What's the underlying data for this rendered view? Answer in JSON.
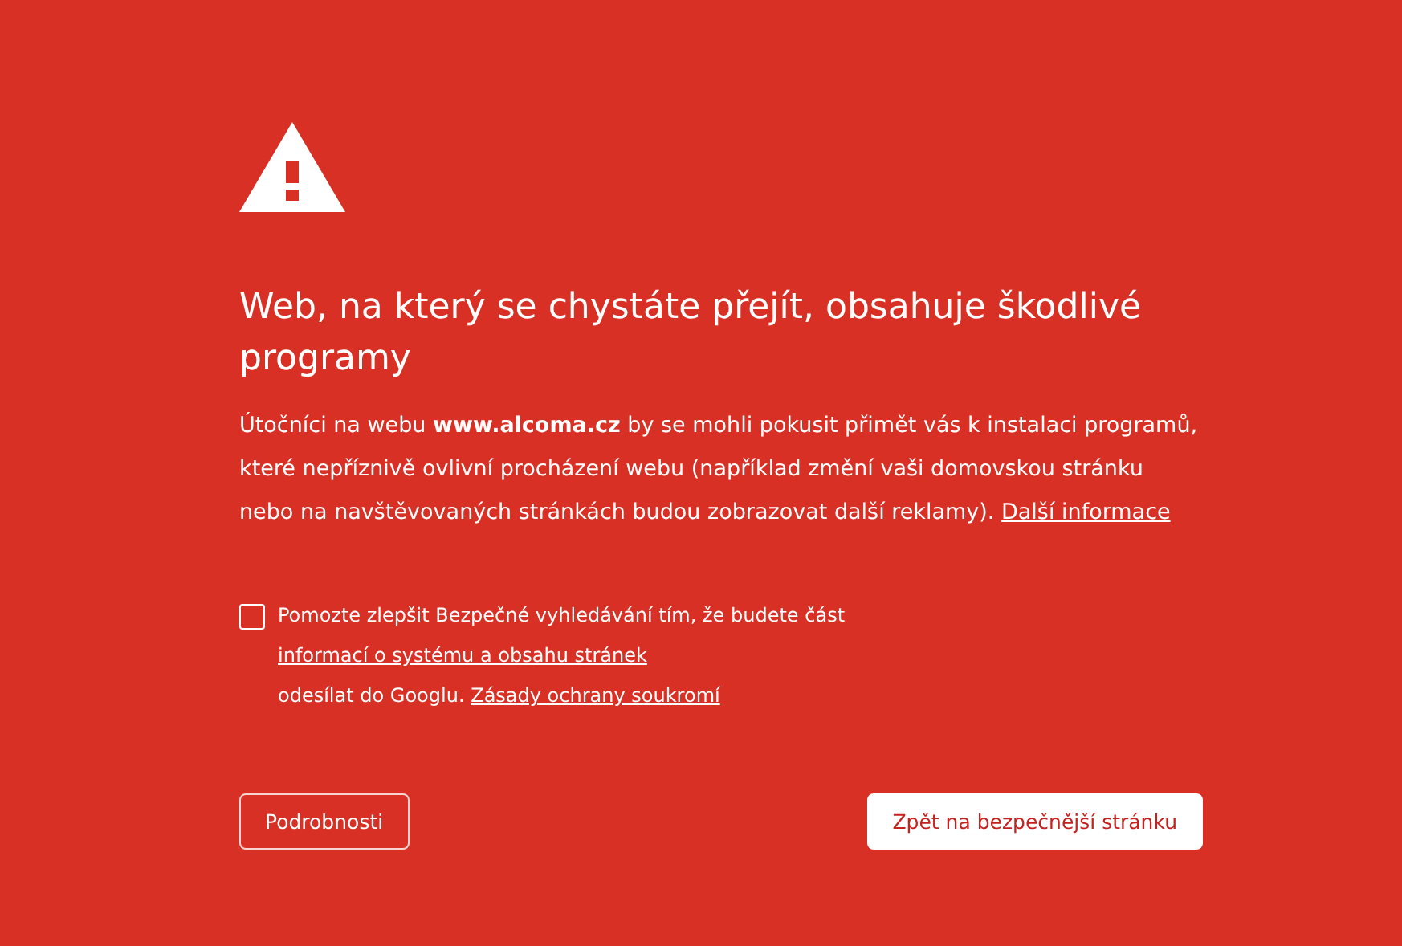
{
  "heading": "Web, na který se chystáte přejít, obsahuje škodlivé programy",
  "message": {
    "text": "Útočníci na webu **www.alcoma.cz** by se mohli pokusit přimět vás k instalaci programů, které nepříznivě ovlivní procházení webu (například změní vaši domovskou stránku nebo na navštěvovaných stránkách budou zobrazovat další reklamy).",
    "link": "Další informace"
  },
  "report": {
    "checked": false,
    "text_1": "Pomozte zlepšit Bezpečné vyhledávání tím, že budete část",
    "link_1": "informací o systému a obsahu stránek",
    "text_2": "odesílat do Googlu.",
    "link_2": "Zásady ochrany soukromí"
  },
  "buttons": [
    {
      "label": "Podrobnosti",
      "kind": "secondary"
    },
    {
      "label": "Zpět na bezpečnější stránku",
      "kind": "primary"
    }
  ]
}
